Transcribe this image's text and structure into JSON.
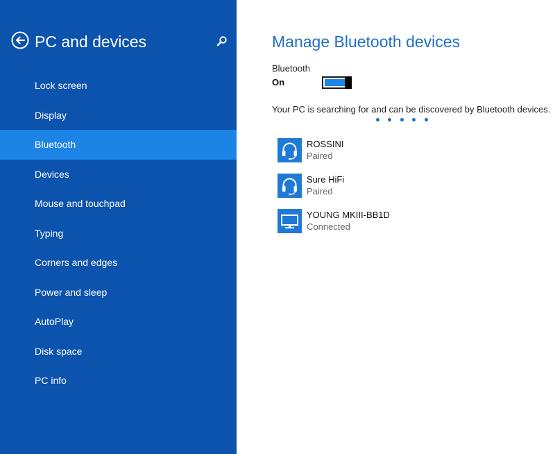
{
  "colors": {
    "sidebar_bg": "#0c53ad",
    "sidebar_selected": "#1c84e6",
    "accent": "#1f6fc5",
    "toggle_on": "#1a86e8"
  },
  "sidebar": {
    "back_icon": "back-arrow-circle-icon",
    "title": "PC and devices",
    "search_icon": "search-icon",
    "items": [
      {
        "label": "Lock screen"
      },
      {
        "label": "Display"
      },
      {
        "label": "Bluetooth",
        "selected": true
      },
      {
        "label": "Devices"
      },
      {
        "label": "Mouse and touchpad"
      },
      {
        "label": "Typing"
      },
      {
        "label": "Corners and edges"
      },
      {
        "label": "Power and sleep"
      },
      {
        "label": "AutoPlay"
      },
      {
        "label": "Disk space"
      },
      {
        "label": "PC info"
      }
    ]
  },
  "main": {
    "title": "Manage Bluetooth devices",
    "bluetooth_label": "Bluetooth",
    "bluetooth_state": "On",
    "bluetooth_on": true,
    "status_text": "Your PC is searching for and can be discovered by Bluetooth devices.",
    "progress_dot_count": 5,
    "devices": [
      {
        "name": "ROSSINI",
        "status": "Paired",
        "icon": "headset-icon"
      },
      {
        "name": "Sure HiFi",
        "status": "Paired",
        "icon": "headset-icon"
      },
      {
        "name": "YOUNG MKIII-BB1D",
        "status": "Connected",
        "icon": "monitor-icon"
      }
    ]
  }
}
